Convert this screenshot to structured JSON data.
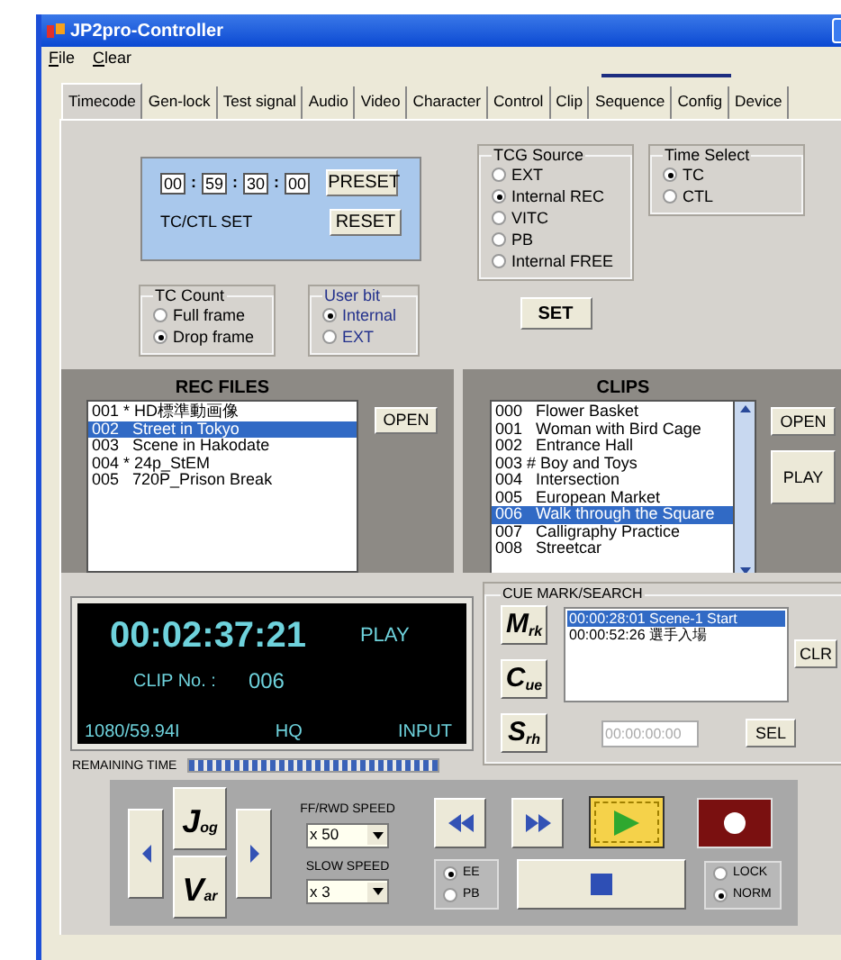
{
  "window": {
    "title": "JP2pro-Controller"
  },
  "menu": [
    "File",
    "Clear"
  ],
  "tabs": [
    {
      "label": "Timecode",
      "selected": true
    },
    {
      "label": "Gen-lock",
      "selected": false
    },
    {
      "label": "Test signal",
      "selected": false
    },
    {
      "label": "Audio",
      "selected": false
    },
    {
      "label": "Video",
      "selected": false
    },
    {
      "label": "Character",
      "selected": false
    },
    {
      "label": "Control",
      "selected": false
    },
    {
      "label": "Clip",
      "selected": false
    },
    {
      "label": "Sequence",
      "selected": false
    },
    {
      "label": "Config",
      "selected": false
    },
    {
      "label": "Device",
      "selected": false
    }
  ],
  "tc_ctl_set": {
    "fields": [
      "00",
      "59",
      "30",
      "00"
    ],
    "separators": [
      ":",
      ":",
      ":"
    ],
    "label": "TC/CTL SET",
    "buttons": [
      "PRESET",
      "RESET"
    ]
  },
  "tc_count": {
    "title": "TC Count",
    "options": [
      {
        "label": "Full frame",
        "selected": false
      },
      {
        "label": "Drop frame",
        "selected": true
      }
    ]
  },
  "user_bit": {
    "title": "User bit",
    "options": [
      {
        "label": "Internal",
        "selected": true
      },
      {
        "label": "EXT",
        "selected": false
      }
    ]
  },
  "tcg_source": {
    "title": "TCG Source",
    "options": [
      {
        "label": "EXT",
        "selected": false
      },
      {
        "label": "Internal REC",
        "selected": true
      },
      {
        "label": "VITC",
        "selected": false
      },
      {
        "label": "PB",
        "selected": false
      },
      {
        "label": "Internal FREE",
        "selected": false
      }
    ]
  },
  "set_button": "SET",
  "time_select": {
    "title": "Time Select",
    "options": [
      {
        "label": "TC",
        "selected": true
      },
      {
        "label": "CTL",
        "selected": false
      }
    ]
  },
  "rec_files": {
    "title": "REC FILES",
    "items": [
      {
        "text": "001 * HD標準動画像",
        "selected": false
      },
      {
        "text": "002   Street in Tokyo",
        "selected": true
      },
      {
        "text": "003   Scene in Hakodate",
        "selected": false
      },
      {
        "text": "004 * 24p_StEM",
        "selected": false
      },
      {
        "text": "005   720P_Prison Break",
        "selected": false
      }
    ],
    "buttons": [
      "OPEN"
    ]
  },
  "clips": {
    "title": "CLIPS",
    "items": [
      {
        "text": "000   Flower Basket",
        "selected": false
      },
      {
        "text": "001   Woman with Bird Cage",
        "selected": false
      },
      {
        "text": "002   Entrance Hall",
        "selected": false
      },
      {
        "text": "003 # Boy and Toys",
        "selected": false
      },
      {
        "text": "004   Intersection",
        "selected": false
      },
      {
        "text": "005   European Market",
        "selected": false
      },
      {
        "text": "006   Walk through the Square",
        "selected": true
      },
      {
        "text": "007   Calligraphy Practice",
        "selected": false
      },
      {
        "text": "008   Streetcar",
        "selected": false
      }
    ],
    "buttons": [
      "OPEN",
      "PLAY"
    ]
  },
  "display": {
    "time": "00:02:37:21",
    "status": "PLAY",
    "clip_label": "CLIP No. :",
    "clip_number": "006",
    "format": "1080/59.94I",
    "quality": "HQ",
    "source": "INPUT"
  },
  "remaining_time": {
    "label": "REMAINING TIME",
    "level": 1
  },
  "cue": {
    "title": "CUE MARK/SEARCH",
    "buttons": [
      {
        "letter": "M",
        "suffix": "rk"
      },
      {
        "letter": "C",
        "suffix": "ue"
      },
      {
        "letter": "S",
        "suffix": "rh"
      }
    ],
    "items": [
      {
        "text": "00:00:28:01 Scene-1 Start",
        "selected": true
      },
      {
        "text": "00:00:52:26 選手入場",
        "selected": false
      }
    ],
    "clear_button": "CLR",
    "search_field": {
      "placeholder": "00:00:00:00"
    },
    "select_button": "SEL"
  },
  "transport": {
    "jog": {
      "letter": "J",
      "suffix": "og"
    },
    "var": {
      "letter": "V",
      "suffix": "ar"
    },
    "ff_rwd_speed": {
      "label": "FF/RWD SPEED",
      "value": "x 50"
    },
    "slow_speed": {
      "label": "SLOW SPEED",
      "value": "x 3"
    },
    "play_selected": true,
    "monitor": [
      {
        "label": "EE",
        "selected": true
      },
      {
        "label": "PB",
        "selected": false
      }
    ],
    "mode": [
      {
        "label": "LOCK",
        "selected": false
      },
      {
        "label": "NORM",
        "selected": true
      }
    ]
  }
}
